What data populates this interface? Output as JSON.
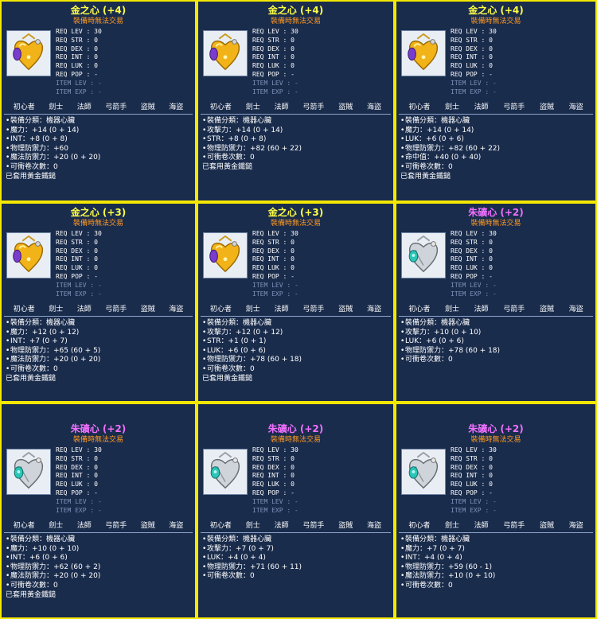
{
  "colors": {
    "border": "#f4e800",
    "panel_bg": "#1a2c4c",
    "title_gold": "#ffff44",
    "title_pink": "#f070ff",
    "subtitle": "#ff9922",
    "dim_text": "#7f92b8"
  },
  "panels": [
    {
      "title": "金之心 (+4)",
      "title_color": "gold",
      "subtitle": "裝備時無法交易",
      "icon": "gold-heart-icon",
      "reqs": [
        {
          "label": "REQ LEV",
          "value": "30",
          "dim": false
        },
        {
          "label": "REQ STR",
          "value": "0",
          "dim": false
        },
        {
          "label": "REQ DEX",
          "value": "0",
          "dim": false
        },
        {
          "label": "REQ INT",
          "value": "0",
          "dim": false
        },
        {
          "label": "REQ LUK",
          "value": "0",
          "dim": false
        },
        {
          "label": "REQ POP",
          "value": "-",
          "dim": false
        },
        {
          "label": "ITEM LEV",
          "value": "-",
          "dim": true
        },
        {
          "label": "ITEM EXP",
          "value": "-",
          "dim": true
        }
      ],
      "jobs": [
        "初心者",
        "劍士",
        "法師",
        "弓箭手",
        "盜賊",
        "海盜"
      ],
      "stats": [
        "裝備分類：機器心臟",
        "魔力：+14 (0 + 14)",
        "INT：+8 (0 + 8)",
        "物理防禦力：+60",
        "魔法防禦力：+20 (0 + 20)",
        "可衝卷次數：0"
      ],
      "set": "已套用黃金鐵鎚"
    },
    {
      "title": "金之心 (+4)",
      "title_color": "gold",
      "subtitle": "裝備時無法交易",
      "icon": "gold-heart-icon",
      "reqs": [
        {
          "label": "REQ LEV",
          "value": "30",
          "dim": false
        },
        {
          "label": "REQ STR",
          "value": "0",
          "dim": false
        },
        {
          "label": "REQ DEX",
          "value": "0",
          "dim": false
        },
        {
          "label": "REQ INT",
          "value": "0",
          "dim": false
        },
        {
          "label": "REQ LUK",
          "value": "0",
          "dim": false
        },
        {
          "label": "REQ POP",
          "value": "-",
          "dim": false
        },
        {
          "label": "ITEM LEV",
          "value": "-",
          "dim": true
        },
        {
          "label": "ITEM EXP",
          "value": "-",
          "dim": true
        }
      ],
      "jobs": [
        "初心者",
        "劍士",
        "法師",
        "弓箭手",
        "盜賊",
        "海盜"
      ],
      "stats": [
        "裝備分類：機器心臟",
        "攻擊力：+14 (0 + 14)",
        "STR：+8 (0 + 8)",
        "物理防禦力：+82 (60 + 22)",
        "可衝卷次數：0"
      ],
      "set": "已套用黃金鐵鎚"
    },
    {
      "title": "金之心 (+4)",
      "title_color": "gold",
      "subtitle": "裝備時無法交易",
      "icon": "gold-heart-icon",
      "reqs": [
        {
          "label": "REQ LEV",
          "value": "30",
          "dim": false
        },
        {
          "label": "REQ STR",
          "value": "0",
          "dim": false
        },
        {
          "label": "REQ DEX",
          "value": "0",
          "dim": false
        },
        {
          "label": "REQ INT",
          "value": "0",
          "dim": false
        },
        {
          "label": "REQ LUK",
          "value": "0",
          "dim": false
        },
        {
          "label": "REQ POP",
          "value": "-",
          "dim": false
        },
        {
          "label": "ITEM LEV",
          "value": "-",
          "dim": true
        },
        {
          "label": "ITEM EXP",
          "value": "-",
          "dim": true
        }
      ],
      "jobs": [
        "初心者",
        "劍士",
        "法師",
        "弓箭手",
        "盜賊",
        "海盜"
      ],
      "stats": [
        "裝備分類：機器心臟",
        "魔力：+14 (0 + 14)",
        "LUK：+6 (0 + 6)",
        "物理防禦力：+82 (60 + 22)",
        "命中值：+40 (0 + 40)",
        "可衝卷次數：0"
      ],
      "set": "已套用黃金鐵鎚"
    },
    {
      "title": "金之心 (+3)",
      "title_color": "gold",
      "subtitle": "裝備時無法交易",
      "icon": "gold-heart-icon",
      "reqs": [
        {
          "label": "REQ LEV",
          "value": "30",
          "dim": false
        },
        {
          "label": "REQ STR",
          "value": "0",
          "dim": false
        },
        {
          "label": "REQ DEX",
          "value": "0",
          "dim": false
        },
        {
          "label": "REQ INT",
          "value": "0",
          "dim": false
        },
        {
          "label": "REQ LUK",
          "value": "0",
          "dim": false
        },
        {
          "label": "REQ POP",
          "value": "-",
          "dim": false
        },
        {
          "label": "ITEM LEV",
          "value": "-",
          "dim": true
        },
        {
          "label": "ITEM EXP",
          "value": "-",
          "dim": true
        }
      ],
      "jobs": [
        "初心者",
        "劍士",
        "法師",
        "弓箭手",
        "盜賊",
        "海盜"
      ],
      "stats": [
        "裝備分類：機器心臟",
        "魔力：+12 (0 + 12)",
        "INT：+7 (0 + 7)",
        "物理防禦力：+65 (60 + 5)",
        "魔法防禦力：+20 (0 + 20)",
        "可衝卷次數：0"
      ],
      "set": "已套用黃金鐵鎚"
    },
    {
      "title": "金之心 (+3)",
      "title_color": "gold",
      "subtitle": "裝備時無法交易",
      "icon": "gold-heart-icon",
      "reqs": [
        {
          "label": "REQ LEV",
          "value": "30",
          "dim": false
        },
        {
          "label": "REQ STR",
          "value": "0",
          "dim": false
        },
        {
          "label": "REQ DEX",
          "value": "0",
          "dim": false
        },
        {
          "label": "REQ INT",
          "value": "0",
          "dim": false
        },
        {
          "label": "REQ LUK",
          "value": "0",
          "dim": false
        },
        {
          "label": "REQ POP",
          "value": "-",
          "dim": false
        },
        {
          "label": "ITEM LEV",
          "value": "-",
          "dim": true
        },
        {
          "label": "ITEM EXP",
          "value": "-",
          "dim": true
        }
      ],
      "jobs": [
        "初心者",
        "劍士",
        "法師",
        "弓箭手",
        "盜賊",
        "海盜"
      ],
      "stats": [
        "裝備分類：機器心臟",
        "攻擊力：+12 (0 + 12)",
        "STR：+1 (0 + 1)",
        "LUK：+6 (0 + 6)",
        "物理防禦力：+78 (60 + 18)",
        "可衝卷次數：0"
      ],
      "set": "已套用黃金鐵鎚"
    },
    {
      "title": "朱礦心 (+2)",
      "title_color": "pink",
      "subtitle": "裝備時無法交易",
      "icon": "silver-heart-icon",
      "reqs": [
        {
          "label": "REQ LEV",
          "value": "30",
          "dim": false
        },
        {
          "label": "REQ STR",
          "value": "0",
          "dim": false
        },
        {
          "label": "REQ DEX",
          "value": "0",
          "dim": false
        },
        {
          "label": "REQ INT",
          "value": "0",
          "dim": false
        },
        {
          "label": "REQ LUK",
          "value": "0",
          "dim": false
        },
        {
          "label": "REQ POP",
          "value": "-",
          "dim": false
        },
        {
          "label": "ITEM LEV",
          "value": "-",
          "dim": true
        },
        {
          "label": "ITEM EXP",
          "value": "-",
          "dim": true
        }
      ],
      "jobs": [
        "初心者",
        "劍士",
        "法師",
        "弓箭手",
        "盜賊",
        "海盜"
      ],
      "stats": [
        "裝備分類：機器心臟",
        "攻擊力：+10 (0 + 10)",
        "LUK：+6 (0 + 6)",
        "物理防禦力：+78 (60 + 18)",
        "可衝卷次數：0"
      ],
      "set": ""
    },
    {
      "title": "朱礦心 (+2)",
      "title_color": "pink",
      "subtitle": "裝備時無法交易",
      "icon": "silver-heart-icon",
      "reqs": [
        {
          "label": "REQ LEV",
          "value": "30",
          "dim": false
        },
        {
          "label": "REQ STR",
          "value": "0",
          "dim": false
        },
        {
          "label": "REQ DEX",
          "value": "0",
          "dim": false
        },
        {
          "label": "REQ INT",
          "value": "0",
          "dim": false
        },
        {
          "label": "REQ LUK",
          "value": "0",
          "dim": false
        },
        {
          "label": "REQ POP",
          "value": "-",
          "dim": false
        },
        {
          "label": "ITEM LEV",
          "value": "-",
          "dim": true
        },
        {
          "label": "ITEM EXP",
          "value": "-",
          "dim": true
        }
      ],
      "jobs": [
        "初心者",
        "劍士",
        "法師",
        "弓箭手",
        "盜賊",
        "海盜"
      ],
      "stats": [
        "裝備分類：機器心臟",
        "魔力：+10 (0 + 10)",
        "INT：+6 (0 + 6)",
        "物理防禦力：+62 (60 + 2)",
        "魔法防禦力：+20 (0 + 20)",
        "可衝卷次數：0"
      ],
      "set": "已套用黃金鐵鎚"
    },
    {
      "title": "朱礦心 (+2)",
      "title_color": "pink",
      "subtitle": "裝備時無法交易",
      "icon": "silver-heart-icon",
      "reqs": [
        {
          "label": "REQ LEV",
          "value": "30",
          "dim": false
        },
        {
          "label": "REQ STR",
          "value": "0",
          "dim": false
        },
        {
          "label": "REQ DEX",
          "value": "0",
          "dim": false
        },
        {
          "label": "REQ INT",
          "value": "0",
          "dim": false
        },
        {
          "label": "REQ LUK",
          "value": "0",
          "dim": false
        },
        {
          "label": "REQ POP",
          "value": "-",
          "dim": false
        },
        {
          "label": "ITEM LEV",
          "value": "-",
          "dim": true
        },
        {
          "label": "ITEM EXP",
          "value": "-",
          "dim": true
        }
      ],
      "jobs": [
        "初心者",
        "劍士",
        "法師",
        "弓箭手",
        "盜賊",
        "海盜"
      ],
      "stats": [
        "裝備分類：機器心臟",
        "攻擊力：+7 (0 + 7)",
        "LUK：+4 (0 + 4)",
        "物理防禦力：+71 (60 + 11)",
        "可衝卷次數：0"
      ],
      "set": ""
    },
    {
      "title": "朱礦心 (+2)",
      "title_color": "pink",
      "subtitle": "裝備時無法交易",
      "icon": "silver-heart-icon",
      "reqs": [
        {
          "label": "REQ LEV",
          "value": "30",
          "dim": false
        },
        {
          "label": "REQ STR",
          "value": "0",
          "dim": false
        },
        {
          "label": "REQ DEX",
          "value": "0",
          "dim": false
        },
        {
          "label": "REQ INT",
          "value": "0",
          "dim": false
        },
        {
          "label": "REQ LUK",
          "value": "0",
          "dim": false
        },
        {
          "label": "REQ POP",
          "value": "-",
          "dim": false
        },
        {
          "label": "ITEM LEV",
          "value": "-",
          "dim": true
        },
        {
          "label": "ITEM EXP",
          "value": "-",
          "dim": true
        }
      ],
      "jobs": [
        "初心者",
        "劍士",
        "法師",
        "弓箭手",
        "盜賊",
        "海盜"
      ],
      "stats": [
        "裝備分類：機器心臟",
        "魔力：+7 (0 + 7)",
        "INT：+4 (0 + 4)",
        "物理防禦力：+59 (60 - 1)",
        "魔法防禦力：+10 (0 + 10)",
        "可衝卷次數：0"
      ],
      "set": ""
    }
  ]
}
